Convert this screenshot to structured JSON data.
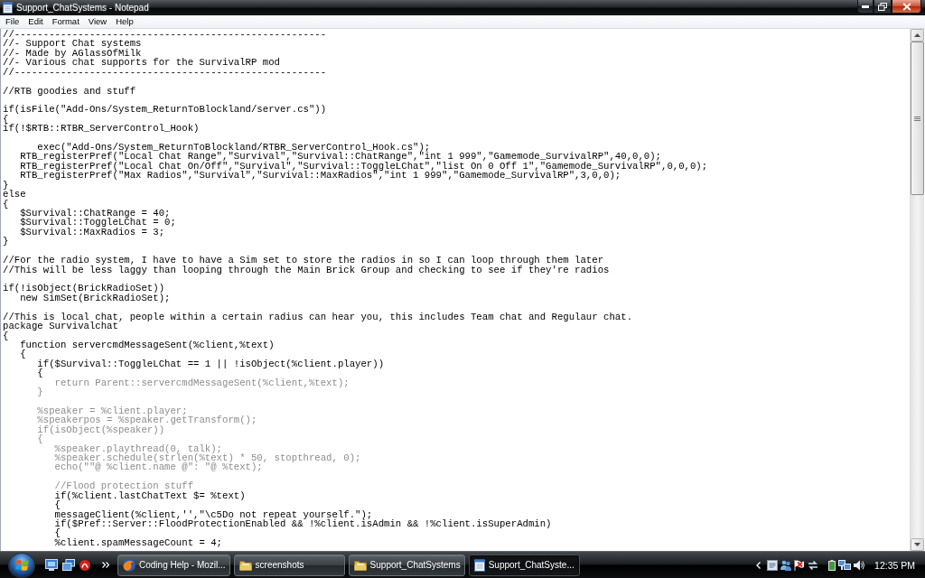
{
  "window": {
    "title": "Support_ChatSystems - Notepad"
  },
  "menu": [
    "File",
    "Edit",
    "Format",
    "View",
    "Help"
  ],
  "editor": {
    "blocks": [
      {
        "lines": [
          {
            "text": "//------------------------------------------------------",
            "faded": false
          },
          {
            "text": "//- Support Chat systems",
            "faded": false
          },
          {
            "text": "//- Made by AGlassOfMilk",
            "faded": false
          },
          {
            "text": "//- Various chat supports for the SurvivalRP mod",
            "faded": false
          },
          {
            "text": "//------------------------------------------------------",
            "faded": false
          }
        ]
      },
      {
        "lines": [
          {
            "text": "//RTB goodies and stuff",
            "faded": false
          }
        ]
      },
      {
        "lines": [
          {
            "text": "if(isFile(\"Add-Ons/System_ReturnToBlockland/server.cs\"))",
            "faded": false
          },
          {
            "text": "{",
            "faded": false
          },
          {
            "text": "if(!$RTB::RTBR_ServerControl_Hook)",
            "faded": false
          }
        ]
      },
      {
        "lines": [
          {
            "text": "      exec(\"Add-Ons/System_ReturnToBlockland/RTBR_ServerControl_Hook.cs\");",
            "faded": false
          },
          {
            "text": "   RTB_registerPref(\"Local Chat Range\",\"Survival\",\"Survival::ChatRange\",\"int 1 999\",\"Gamemode_SurvivalRP\",40,0,0);",
            "faded": false
          },
          {
            "text": "   RTB_registerPref(\"Local Chat On/Off\",\"Survival\",\"Survival::ToggleLChat\",\"list On 0 Off 1\",\"Gamemode_SurvivalRP\",0,0,0);",
            "faded": false
          },
          {
            "text": "   RTB_registerPref(\"Max Radios\",\"Survival\",\"Survival::MaxRadios\",\"int 1 999\",\"Gamemode_SurvivalRP\",3,0,0);",
            "faded": false
          },
          {
            "text": "}",
            "faded": false
          },
          {
            "text": "else",
            "faded": false
          },
          {
            "text": "{",
            "faded": false
          },
          {
            "text": "   $Survival::ChatRange = 40;",
            "faded": false
          },
          {
            "text": "   $Survival::ToggleLChat = 0;",
            "faded": false
          },
          {
            "text": "   $Survival::MaxRadios = 3;",
            "faded": false
          },
          {
            "text": "}",
            "faded": false
          }
        ]
      },
      {
        "lines": [
          {
            "text": "//For the radio system, I have to have a Sim set to store the radios in so I can loop through them later",
            "faded": false
          },
          {
            "text": "//This will be less laggy than looping through the Main Brick Group and checking to see if they're radios",
            "faded": false
          }
        ]
      },
      {
        "lines": [
          {
            "text": "if(!isObject(BrickRadioSet))",
            "faded": false
          },
          {
            "text": "   new SimSet(BrickRadioSet);",
            "faded": false
          }
        ]
      },
      {
        "lines": [
          {
            "text": "//This is local chat, people within a certain radius can hear you, this includes Team chat and Regulaur chat.",
            "faded": false
          },
          {
            "text": "package Survivalchat",
            "faded": false
          },
          {
            "text": "{",
            "faded": false
          },
          {
            "text": "   function servercmdMessageSent(%client,%text)",
            "faded": false
          },
          {
            "text": "   {",
            "faded": false
          },
          {
            "text": "      if($Survival::ToggleLChat == 1 || !isObject(%client.player))",
            "faded": false
          },
          {
            "text": "      {",
            "faded": false
          },
          {
            "text": "         return Parent::servercmdMessageSent(%client,%text);",
            "faded": true
          },
          {
            "text": "      }",
            "faded": true
          }
        ]
      },
      {
        "lines": [
          {
            "text": "      %speaker = %client.player;",
            "faded": true
          },
          {
            "text": "      %speakerpos = %speaker.getTransform();",
            "faded": true
          },
          {
            "text": "      if(isObject(%speaker))",
            "faded": true
          },
          {
            "text": "      {",
            "faded": true
          },
          {
            "text": "         %speaker.playthread(0, talk);",
            "faded": true
          },
          {
            "text": "         %speaker.schedule(strlen(%text) * 50, stopthread, 0);",
            "faded": true
          },
          {
            "text": "         echo(\"\"@ %client.name @\": \"@ %text);",
            "faded": true
          }
        ]
      },
      {
        "lines": [
          {
            "text": "         //Flood protection stuff",
            "faded": true
          },
          {
            "text": "         if(%client.lastChatText $= %text)",
            "faded": false
          },
          {
            "text": "         {",
            "faded": false
          },
          {
            "text": "         messageClient(%client,'',\"\\c5Do not repeat yourself.\");",
            "faded": false
          },
          {
            "text": "         if($Pref::Server::FloodProtectionEnabled && !%client.isAdmin && !%client.isSuperAdmin)",
            "faded": false
          },
          {
            "text": "         {",
            "faded": false
          },
          {
            "text": "         %client.spamMessageCount = 4;",
            "faded": false
          }
        ]
      }
    ]
  },
  "taskbar": {
    "tasks": [
      {
        "label": "Coding Help - Mozil...",
        "kind": "browser",
        "selected": false
      },
      {
        "label": "screenshots",
        "kind": "folder",
        "selected": false
      },
      {
        "label": "Support_ChatSystems",
        "kind": "folder",
        "selected": false
      },
      {
        "label": "Support_ChatSyste...",
        "kind": "notepad",
        "selected": true
      }
    ],
    "clock": "12:35 PM"
  }
}
